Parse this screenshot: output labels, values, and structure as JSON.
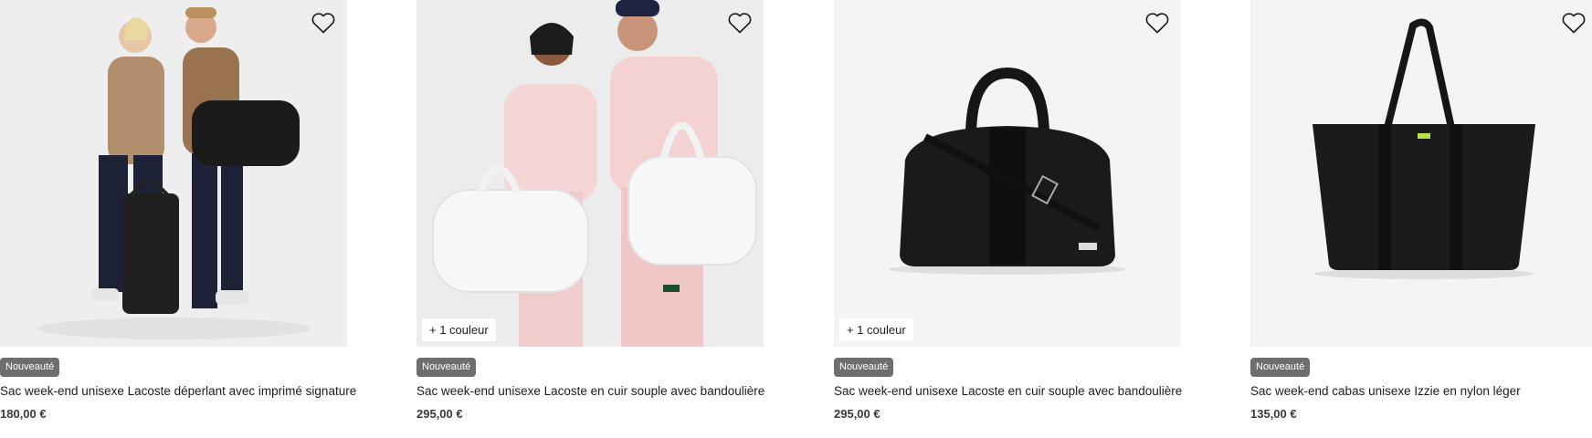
{
  "products": [
    {
      "badge": "Nouveauté",
      "title": "Sac week-end unisexe Lacoste déperlant avec imprimé signature",
      "price": "180,00 €",
      "colors_label": "",
      "favorite_icon": "heart-outline-icon"
    },
    {
      "badge": "Nouveauté",
      "title": "Sac week-end unisexe Lacoste en cuir souple avec bandoulière",
      "price": "295,00 €",
      "colors_label": "+ 1 couleur",
      "favorite_icon": "heart-outline-icon"
    },
    {
      "badge": "Nouveauté",
      "title": "Sac week-end unisexe Lacoste en cuir souple avec bandoulière",
      "price": "295,00 €",
      "colors_label": "+ 1 couleur",
      "favorite_icon": "heart-outline-icon"
    },
    {
      "badge": "Nouveauté",
      "title": "Sac week-end cabas unisexe Izzie en nylon léger",
      "price": "135,00 €",
      "colors_label": "",
      "favorite_icon": "heart-outline-icon"
    }
  ],
  "colors": {
    "badge_bg": "#6e6e6e",
    "image_bg": "#f3f3f3",
    "text": "#1c1c1c"
  }
}
